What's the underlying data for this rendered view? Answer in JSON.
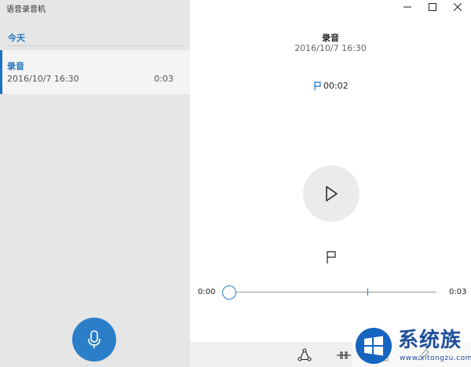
{
  "app": {
    "title": "语音录音机"
  },
  "sidebar": {
    "group_header": "今天",
    "recordings": [
      {
        "name": "录音",
        "date": "2016/10/7 16:30",
        "duration": "0:03"
      }
    ]
  },
  "window_controls": {
    "icons": [
      "minimize-icon",
      "maximize-icon",
      "close-icon"
    ]
  },
  "player": {
    "title": "录音",
    "date": "2016/10/7 16:30",
    "marker_time": "00:02",
    "time_start": "0:00",
    "time_end": "0:03",
    "progress_fraction": 0.0,
    "marker_fraction": 0.6667
  },
  "bottom_toolbar": {
    "icons": [
      "share-icon",
      "trim-icon",
      "delete-icon",
      "rename-icon"
    ]
  },
  "watermark": {
    "text": "系统族",
    "url": "www.xitongzu.com"
  },
  "colors": {
    "accent": "#1e73be",
    "mic": "#2b7fc8",
    "sidebar_bg": "#e6e6e6"
  }
}
